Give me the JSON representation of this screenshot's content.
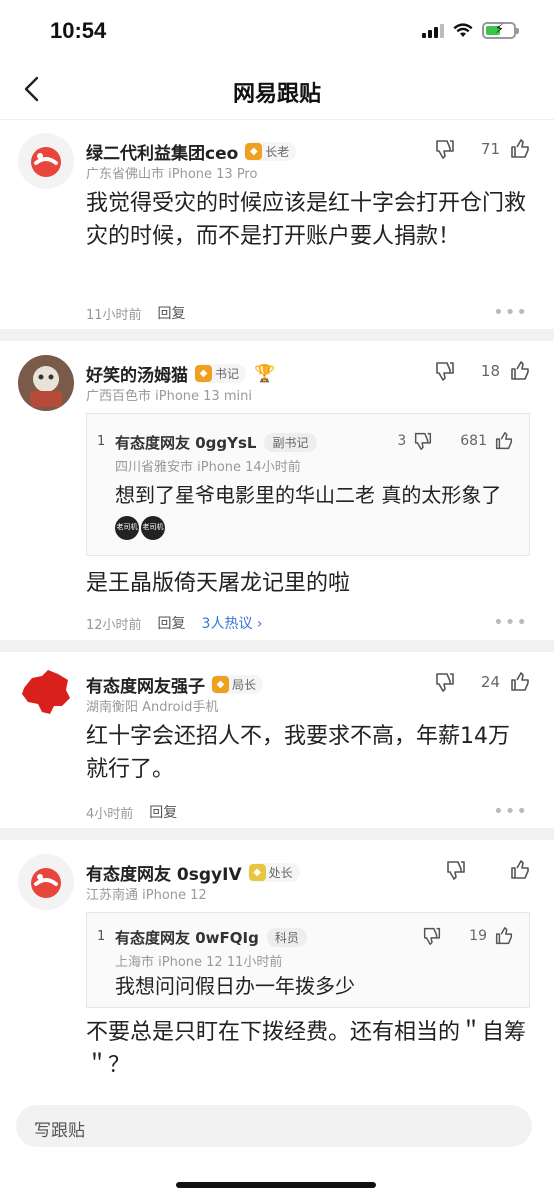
{
  "status_bar": {
    "time": "10:54"
  },
  "nav": {
    "title": "网易跟贴"
  },
  "comments": [
    {
      "user": "绿二代利益集团ceo",
      "badge": "长老",
      "meta": "广东省佛山市  iPhone 13 Pro",
      "votes": "71",
      "body": "我觉得受灾的时候应该是红十字会打开仓门救灾的时候，而不是打开账户要人捐款！",
      "time": "11小时前",
      "reply": "回复",
      "more": "•••"
    },
    {
      "user": "好笑的汤姆猫",
      "badge": "书记",
      "meta": "广西百色市  iPhone 13 mini",
      "votes": "18",
      "quote": {
        "num": "1",
        "user": "有态度网友 0ggYsL",
        "badge": "副书记",
        "down_votes": "3",
        "votes": "681",
        "meta": "四川省雅安市  iPhone  14小时前",
        "body": "想到了星爷电影里的华山二老 真的太形象了",
        "emoji_label": "老司机"
      },
      "body": "是王晶版倚天屠龙记里的啦",
      "time": "12小时前",
      "reply": "回复",
      "hot": "3人热议 ›",
      "more": "•••"
    },
    {
      "user": "有态度网友强子",
      "badge": "局长",
      "meta": "湖南衡阳  Android手机",
      "votes": "24",
      "body": "红十字会还招人不，我要求不高，年薪14万就行了。",
      "time": "4小时前",
      "reply": "回复",
      "more": "•••"
    },
    {
      "user": "有态度网友 0sgyIV",
      "badge": "处长",
      "meta": "江苏南通  iPhone 12",
      "quote": {
        "num": "1",
        "user": "有态度网友 0wFQIg",
        "badge": "科员",
        "votes": "19",
        "meta": "上海市  iPhone 12  11小时前",
        "body": "我想问问假日办一年拨多少"
      },
      "body": "不要总是只盯在下拨经费。还有相当的＂自筹＂？"
    }
  ],
  "compose": {
    "placeholder": "写跟贴"
  },
  "colors": {
    "link": "#3575d5",
    "badge": "#f0a020",
    "battery": "#3ac54a"
  }
}
